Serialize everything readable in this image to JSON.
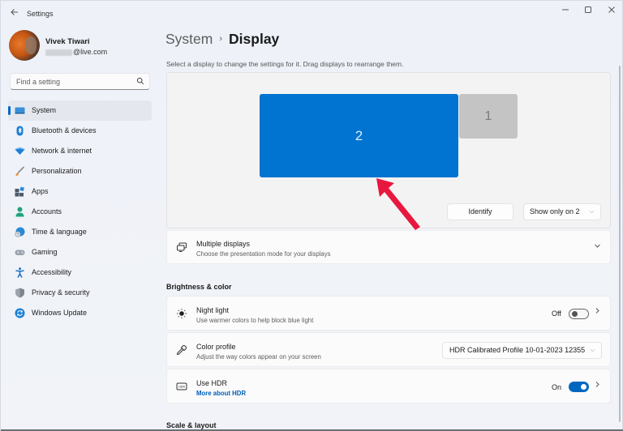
{
  "window": {
    "app_title": "Settings",
    "controls": {
      "minimize": "—",
      "maximize": "☐",
      "close": "✕"
    }
  },
  "profile": {
    "name": "Vivek Tiwari",
    "email_visible": "@live.com"
  },
  "search": {
    "placeholder": "Find a setting"
  },
  "sidebar": {
    "items": [
      {
        "label": "System",
        "icon": "system-icon",
        "active": true
      },
      {
        "label": "Bluetooth & devices",
        "icon": "bluetooth-icon"
      },
      {
        "label": "Network & internet",
        "icon": "wifi-icon"
      },
      {
        "label": "Personalization",
        "icon": "brush-icon"
      },
      {
        "label": "Apps",
        "icon": "apps-icon"
      },
      {
        "label": "Accounts",
        "icon": "account-icon"
      },
      {
        "label": "Time & language",
        "icon": "globe-clock-icon"
      },
      {
        "label": "Gaming",
        "icon": "gamepad-icon"
      },
      {
        "label": "Accessibility",
        "icon": "accessibility-icon"
      },
      {
        "label": "Privacy & security",
        "icon": "shield-icon"
      },
      {
        "label": "Windows Update",
        "icon": "update-icon"
      }
    ]
  },
  "main": {
    "breadcrumb": {
      "parent": "System",
      "separator": "›",
      "current": "Display"
    },
    "subtitle": "Select a display to change the settings for it. Drag displays to rearrange them.",
    "displays": {
      "selected_label": "2",
      "other_label": "1",
      "identify_label": "Identify",
      "mode_dropdown_value": "Show only on 2"
    },
    "multiple_displays": {
      "title": "Multiple displays",
      "description": "Choose the presentation mode for your displays"
    },
    "brightness_section": "Brightness & color",
    "night_light": {
      "title": "Night light",
      "description": "Use warmer colors to help block blue light",
      "state_label": "Off",
      "enabled": false
    },
    "color_profile": {
      "title": "Color profile",
      "description": "Adjust the way colors appear on your screen",
      "value": "HDR Calibrated Profile 10-01-2023 12355"
    },
    "use_hdr": {
      "title": "Use HDR",
      "link": "More about HDR",
      "state_label": "On",
      "enabled": true
    },
    "scale_section": "Scale & layout"
  },
  "colors": {
    "accent": "#0067c0",
    "selected_display": "#0074d0",
    "other_display": "#c4c4c4",
    "annotation_arrow": "#e8173f"
  }
}
